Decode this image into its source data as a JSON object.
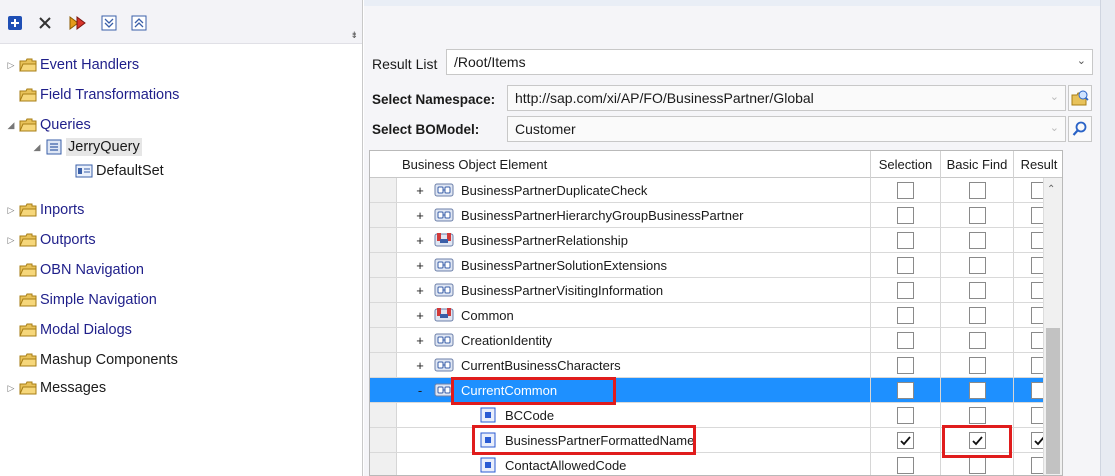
{
  "toolbar": {
    "buttons": [
      "add-icon",
      "delete-icon",
      "run-icon",
      "expand-all-icon",
      "collapse-all-icon"
    ],
    "overflow": "⇟"
  },
  "tree": {
    "items": [
      {
        "label": "Event Handlers",
        "expander": "▷"
      },
      {
        "label": "Field Transformations",
        "expander": ""
      },
      {
        "label": "Queries",
        "expander": "◢"
      },
      {
        "label": "JerryQuery",
        "expander": "◢"
      },
      {
        "label": "DefaultSet",
        "expander": ""
      },
      {
        "label": "Inports",
        "expander": "▷"
      },
      {
        "label": "Outports",
        "expander": "▷"
      },
      {
        "label": "OBN Navigation",
        "expander": ""
      },
      {
        "label": "Simple Navigation",
        "expander": ""
      },
      {
        "label": "Modal Dialogs",
        "expander": ""
      },
      {
        "label": "Mashup Components",
        "expander": ""
      },
      {
        "label": "Messages",
        "expander": "▷"
      }
    ]
  },
  "form": {
    "result_list_label": "Result List",
    "result_list_value": "/Root/Items",
    "namespace_label": "Select Namespace:",
    "namespace_value": "http://sap.com/xi/AP/FO/BusinessPartner/Global",
    "bomodel_label": "Select BOModel:",
    "bomodel_value": "Customer"
  },
  "grid": {
    "headers": {
      "element": "Business Object Element",
      "selection": "Selection",
      "basic_find": "Basic Find",
      "result": "Result"
    },
    "rows": [
      {
        "expander": "+",
        "label": "BusinessPartnerDuplicateCheck",
        "icon": "association-icon",
        "selection": false,
        "basic_find": false,
        "result": false
      },
      {
        "expander": "+",
        "label": "BusinessPartnerHierarchyGroupBusinessPartner",
        "icon": "association-icon",
        "selection": false,
        "basic_find": false,
        "result": false
      },
      {
        "expander": "+",
        "label": "BusinessPartnerRelationship",
        "icon": "relationship-icon",
        "selection": false,
        "basic_find": false,
        "result": false
      },
      {
        "expander": "+",
        "label": "BusinessPartnerSolutionExtensions",
        "icon": "association-icon",
        "selection": false,
        "basic_find": false,
        "result": false
      },
      {
        "expander": "+",
        "label": "BusinessPartnerVisitingInformation",
        "icon": "association-icon",
        "selection": false,
        "basic_find": false,
        "result": false
      },
      {
        "expander": "+",
        "label": "Common",
        "icon": "relationship-icon",
        "selection": false,
        "basic_find": false,
        "result": false
      },
      {
        "expander": "+",
        "label": "CreationIdentity",
        "icon": "association-icon",
        "selection": false,
        "basic_find": false,
        "result": false
      },
      {
        "expander": "+",
        "label": "CurrentBusinessCharacters",
        "icon": "association-icon",
        "selection": false,
        "basic_find": false,
        "result": false
      },
      {
        "expander": "-",
        "label": "CurrentCommon",
        "icon": "association-icon",
        "selection": false,
        "basic_find": false,
        "result": false
      },
      {
        "expander": "",
        "label": "BCCode",
        "icon": "element-icon",
        "selection": false,
        "basic_find": false,
        "result": false
      },
      {
        "expander": "",
        "label": "BusinessPartnerFormattedName",
        "icon": "element-icon",
        "selection": true,
        "basic_find": true,
        "result": true
      },
      {
        "expander": "",
        "label": "ContactAllowedCode",
        "icon": "element-icon",
        "selection": false,
        "basic_find": false,
        "result": false
      }
    ]
  },
  "colors": {
    "highlight": "#1e90ff",
    "annotation": "#e01c1c"
  }
}
